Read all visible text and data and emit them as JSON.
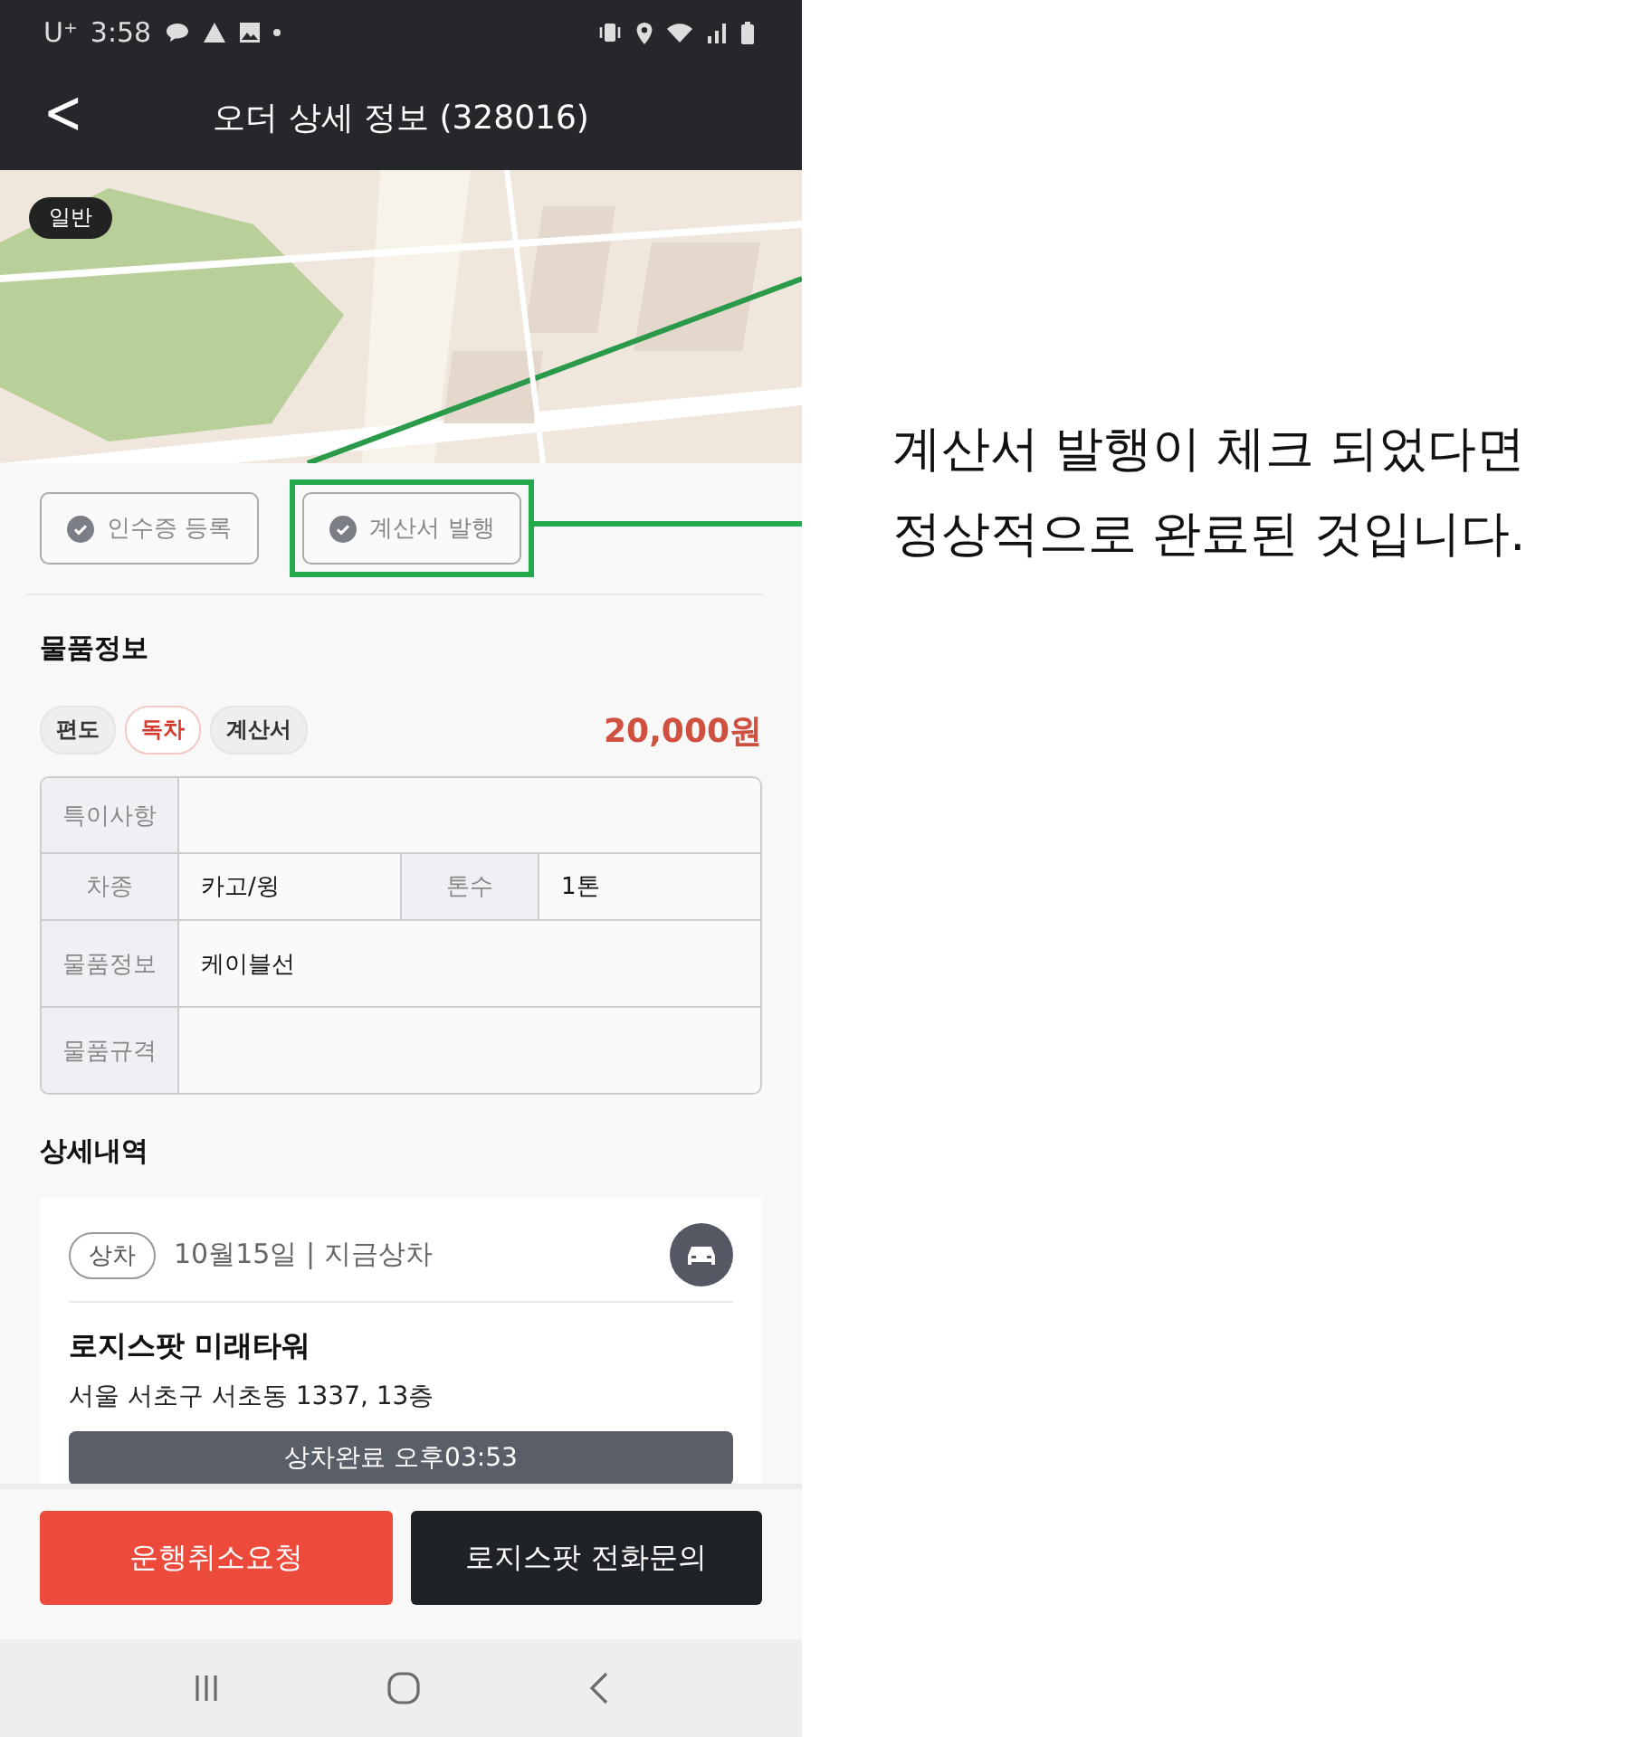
{
  "status_bar": {
    "carrier": "U⁺",
    "time": "3:58"
  },
  "header": {
    "back": "<",
    "title": "오더 상세 정보 (328016)"
  },
  "map": {
    "kind": "picture",
    "badge": "일반"
  },
  "actions": [
    {
      "label": "인수증 등록",
      "highlighted": false
    },
    {
      "label": "계산서 발행",
      "highlighted": true
    }
  ],
  "goods": {
    "heading": "물품정보",
    "tags": [
      {
        "label": "편도",
        "color": "#333333"
      },
      {
        "label": "독차",
        "color": "#d63a2c"
      },
      {
        "label": "계산서",
        "color": "#333333"
      }
    ],
    "price": "20,000원",
    "rows": [
      [
        {
          "label": "특이사항"
        }
      ],
      [
        {
          "label": "차종",
          "value": "카고/윙"
        },
        {
          "label": "톤수",
          "value": "1톤"
        }
      ],
      [
        {
          "label": "물품정보",
          "value": "케이블선"
        }
      ],
      [
        {
          "label": "물품규격"
        }
      ]
    ]
  },
  "details": {
    "heading": "상세내역",
    "stop": {
      "tag": "상차",
      "date": "10월15일 | 지금상차",
      "name": "로지스팟 미래타워",
      "address": "서울 서초구 서초동 1337, 13층",
      "status_button": "상차완료 오후03:53"
    }
  },
  "bottom_buttons": [
    {
      "label": "운행취소요청",
      "kind": "danger"
    },
    {
      "label": "로지스팟 전화문의",
      "kind": "dark"
    }
  ],
  "nav_bar": [
    {
      "kind": "recent"
    },
    {
      "kind": "home"
    },
    {
      "kind": "back"
    }
  ],
  "callout": {
    "lines": [
      "계산서 발행이 체크 되었다면",
      "정상적으로 완료된 것입니다."
    ]
  }
}
